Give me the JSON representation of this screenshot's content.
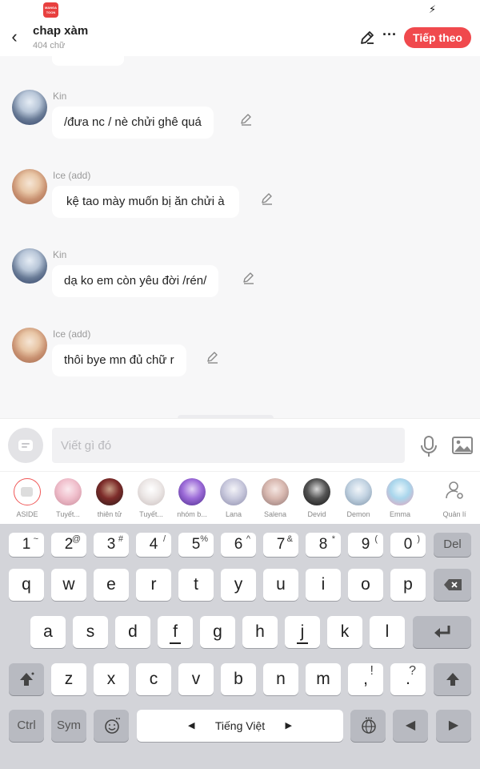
{
  "header": {
    "title": "chap xàm",
    "subtitle": "404 chữ",
    "next_label": "Tiếp theo"
  },
  "messages": [
    {
      "sender": "Kin",
      "text": "/đưa nc / nè chửi ghê  quá"
    },
    {
      "sender": "Ice (add)",
      "text": "kệ tao mày muốn bị ăn chửi à"
    },
    {
      "sender": "Kin",
      "text": "dạ ko em còn yêu đời /rén/"
    },
    {
      "sender": "Ice (add)",
      "text": "thôi bye mn đủ chữ r"
    }
  ],
  "composer": {
    "placeholder": "Viết gì đó"
  },
  "characters": [
    {
      "name": "ASIDE"
    },
    {
      "name": "Tuyết..."
    },
    {
      "name": "thiên tử"
    },
    {
      "name": "Tuyết..."
    },
    {
      "name": "nhóm b..."
    },
    {
      "name": "Lana"
    },
    {
      "name": "Salena"
    },
    {
      "name": "Devid"
    },
    {
      "name": "Demon"
    },
    {
      "name": "Emma"
    }
  ],
  "manage_label": "Quản lí",
  "keyboard": {
    "number_row": [
      {
        "main": "1",
        "sup": "~"
      },
      {
        "main": "2",
        "sup": "@"
      },
      {
        "main": "3",
        "sup": "#"
      },
      {
        "main": "4",
        "sup": "/"
      },
      {
        "main": "5",
        "sup": "%"
      },
      {
        "main": "6",
        "sup": "^"
      },
      {
        "main": "7",
        "sup": "&"
      },
      {
        "main": "8",
        "sup": "*"
      },
      {
        "main": "9",
        "sup": "("
      },
      {
        "main": "0",
        "sup": ")"
      }
    ],
    "del_label": "Del",
    "row1": [
      "q",
      "w",
      "e",
      "r",
      "t",
      "y",
      "u",
      "i",
      "o",
      "p"
    ],
    "row2": [
      "a",
      "s",
      "d",
      "f",
      "g",
      "h",
      "j",
      "k",
      "l"
    ],
    "row3": [
      "z",
      "x",
      "c",
      "v",
      "b",
      "n",
      "m"
    ],
    "row3_punct": [
      {
        "main": ",",
        "sup": "!"
      },
      {
        "main": ".",
        "sup": "?"
      }
    ],
    "ctrl_label": "Ctrl",
    "sym_label": "Sym",
    "space_label": "Tiếng Việt"
  },
  "colors": {
    "accent": "#f0494d",
    "keyboard_bg": "#d3d4d9"
  }
}
